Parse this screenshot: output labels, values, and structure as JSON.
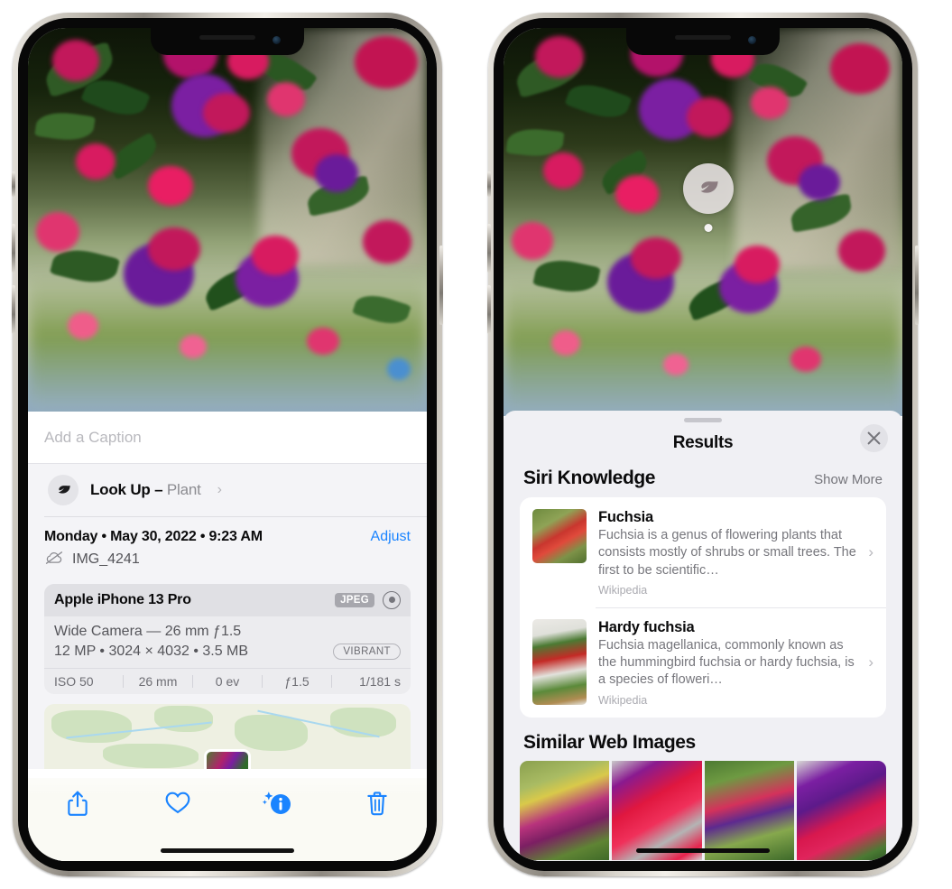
{
  "left_phone": {
    "name": "photos-detail-view",
    "caption": {
      "placeholder": "Add a Caption",
      "value": ""
    },
    "lookup": {
      "icon": "leaf-icon",
      "label": "Look Up",
      "separator": "–",
      "subject": "Plant",
      "chevron": "›"
    },
    "metadata": {
      "date_line": "Monday • May 30, 2022 • 9:23 AM",
      "adjust_label": "Adjust",
      "cloud_icon": "cloud-slash-icon",
      "filename": "IMG_4241"
    },
    "camera_card": {
      "device": "Apple iPhone 13 Pro",
      "format_badge": "JPEG",
      "aperture_icon": "aperture-icon",
      "lens_line": "Wide Camera — 26 mm ƒ1.5",
      "size_line": "12 MP • 3024 × 4032 • 3.5 MB",
      "style_badge": "VIBRANT",
      "exif": [
        "ISO 50",
        "26 mm",
        "0 ev",
        "ƒ1.5",
        "1/181 s"
      ]
    },
    "toolbar": [
      {
        "name": "share-button",
        "icon": "share-icon"
      },
      {
        "name": "favorite-button",
        "icon": "heart-icon"
      },
      {
        "name": "info-button",
        "icon": "info-sparkle-icon"
      },
      {
        "name": "delete-button",
        "icon": "trash-icon"
      }
    ],
    "accent_color": "#1a84ff"
  },
  "right_phone": {
    "name": "visual-lookup-results",
    "photo_badge": {
      "icon": "leaf-icon",
      "name": "visual-lookup-badge"
    },
    "sheet": {
      "title": "Results",
      "close_icon": "close-icon",
      "sections": [
        {
          "title": "Siri Knowledge",
          "action": "Show More",
          "items": [
            {
              "title": "Fuchsia",
              "description": "Fuchsia is a genus of flowering plants that consists mostly of shrubs or small trees. The first to be scientific…",
              "source": "Wikipedia",
              "chevron": "›"
            },
            {
              "title": "Hardy fuchsia",
              "description": "Fuchsia magellanica, commonly known as the hummingbird fuchsia or hardy fuchsia, is a species of floweri…",
              "source": "Wikipedia",
              "chevron": "›"
            }
          ]
        },
        {
          "title": "Similar Web Images",
          "action": "",
          "thumbnails": [
            "web-image-1",
            "web-image-2",
            "web-image-3",
            "web-image-4"
          ]
        }
      ]
    }
  },
  "colors": {
    "accent": "#1a84ff",
    "sheet_bg": "#f0f0f4",
    "card_bg": "#ffffff",
    "secondary_text": "#76767c"
  }
}
